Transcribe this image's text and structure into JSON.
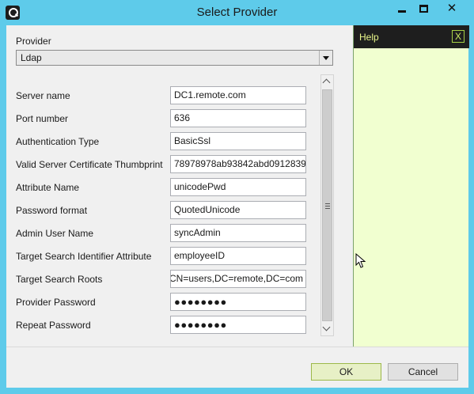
{
  "window": {
    "title": "Select Provider",
    "close_glyph": "✕"
  },
  "provider": {
    "label": "Provider",
    "selected": "Ldap"
  },
  "fields": [
    {
      "label": "Server name",
      "value": "DC1.remote.com"
    },
    {
      "label": "Port number",
      "value": "636"
    },
    {
      "label": "Authentication Type",
      "value": "BasicSsl"
    },
    {
      "label": "Valid Server Certificate Thumbprint",
      "value": "78978978ab93842abd0912839"
    },
    {
      "label": "Attribute Name",
      "value": "unicodePwd"
    },
    {
      "label": "Password format",
      "value": "QuotedUnicode"
    },
    {
      "label": "Admin User Name",
      "value": "syncAdmin"
    },
    {
      "label": "Target Search Identifier Attribute",
      "value": "employeeID"
    },
    {
      "label": "Target Search Roots",
      "value": "CN=users,DC=remote,DC=com"
    },
    {
      "label": "Provider Password",
      "value": "●●●●●●●●"
    },
    {
      "label": "Repeat Password",
      "value": "●●●●●●●●"
    }
  ],
  "help": {
    "title": "Help",
    "close_label": "X"
  },
  "buttons": {
    "ok": "OK",
    "cancel": "Cancel"
  },
  "colors": {
    "titlebar": "#5ecbea",
    "help_bg": "#f1ffd0",
    "help_header": "#1e1e1e"
  }
}
